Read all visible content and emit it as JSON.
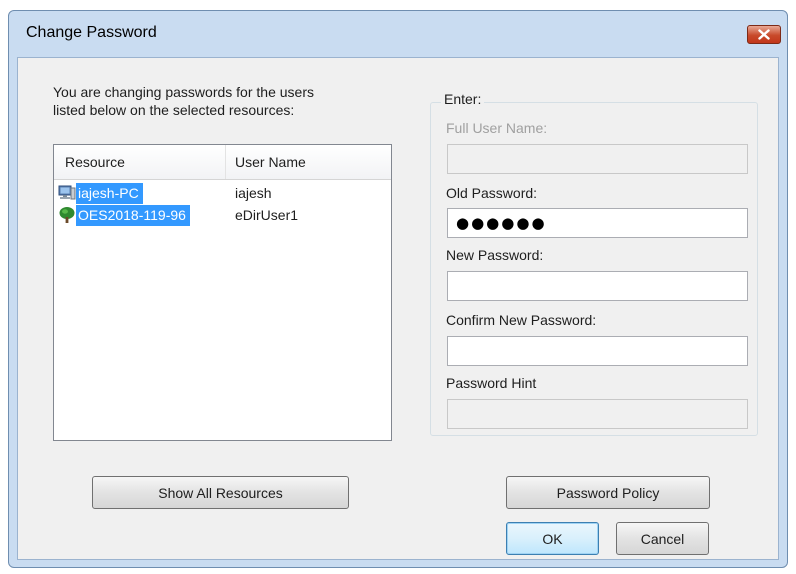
{
  "window": {
    "title": "Change Password"
  },
  "instructions": {
    "line1": "You are changing passwords for the users",
    "line2": "listed below on the selected resources:"
  },
  "resources": {
    "columns": [
      "Resource",
      "User Name"
    ],
    "rows": [
      {
        "resource": "iajesh-PC",
        "user": "iajesh",
        "icon": "computer-icon",
        "selected": true
      },
      {
        "resource": "OES2018-119-96",
        "user": "eDirUser1",
        "icon": "tree-icon",
        "selected": true
      }
    ]
  },
  "enter_group": {
    "legend": "Enter:",
    "full_user_name_label": "Full User Name:",
    "full_user_name_value": "",
    "old_password_label": "Old Password:",
    "old_password_value": "●●●●●●",
    "new_password_label": "New Password:",
    "new_password_value": "",
    "confirm_password_label": "Confirm New Password:",
    "confirm_password_value": "",
    "password_hint_label": "Password Hint",
    "password_hint_value": ""
  },
  "buttons": {
    "show_all_resources": "Show All Resources",
    "password_policy": "Password Policy",
    "ok": "OK",
    "cancel": "Cancel"
  },
  "colors": {
    "selection": "#3399ff",
    "frame": "#c9dcf1",
    "close_button": "#c84a2b"
  }
}
